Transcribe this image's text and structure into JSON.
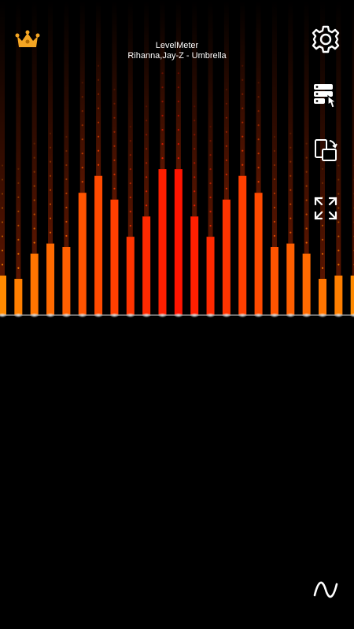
{
  "header": {
    "app_title": "LevelMeter",
    "now_playing": "Rihanna,Jay-Z - Umbrella"
  },
  "icons": {
    "premium": "crown-icon",
    "settings": "gear-icon",
    "manage": "server-touch-icon",
    "rotate": "rotate-screen-icon",
    "fullscreen": "expand-icon",
    "mode": "sine-wave-icon"
  },
  "colors": {
    "background": "#000000",
    "bar_outer": "#ff8a00",
    "bar_center": "#ff1400",
    "crown": "#f5a623",
    "icon": "#ffffff"
  },
  "meter": {
    "levels": [
      0.23,
      0.21,
      0.36,
      0.42,
      0.4,
      0.72,
      0.82,
      0.68,
      0.46,
      0.58,
      0.86,
      0.86,
      0.58,
      0.46,
      0.68,
      0.82,
      0.72,
      0.4,
      0.42,
      0.36,
      0.21,
      0.23,
      0.23
    ]
  }
}
